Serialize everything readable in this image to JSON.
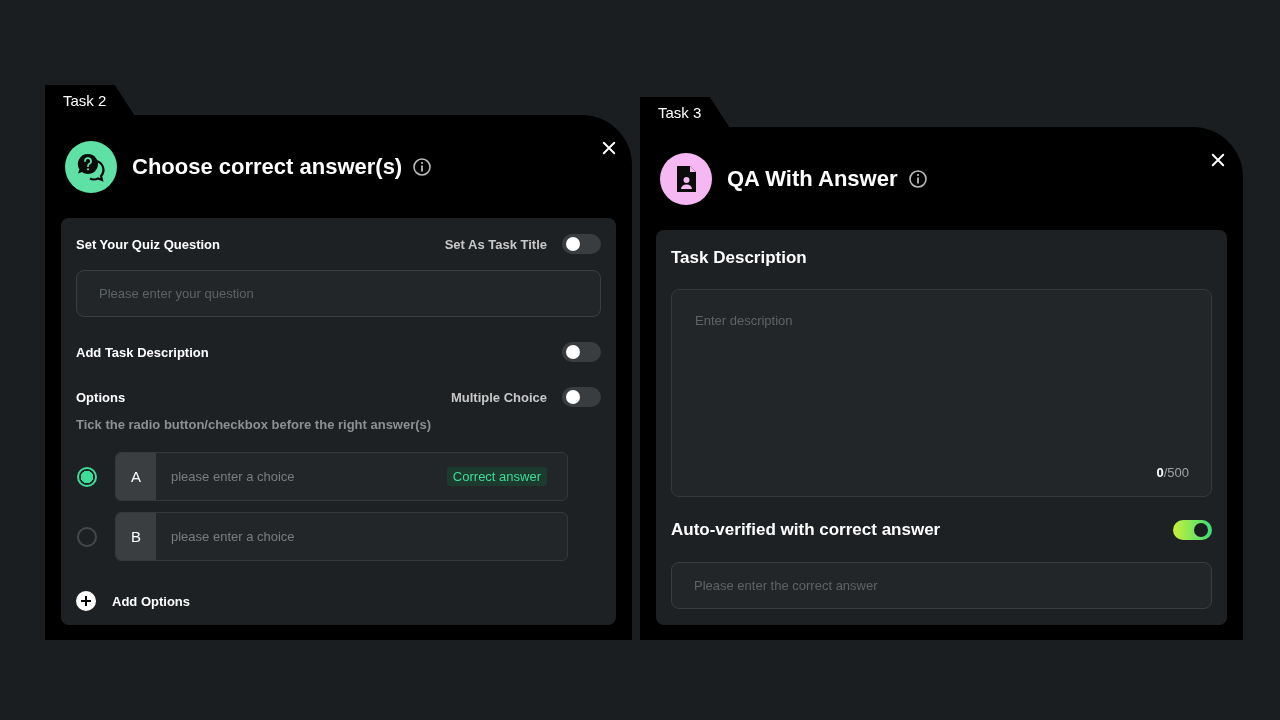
{
  "tasks": [
    {
      "kind": "quiz",
      "tab": "Task 2",
      "title": "Choose correct answer(s)",
      "question": {
        "label": "Set Your Quiz Question",
        "toggle_label": "Set As Task Title",
        "toggle_on": false,
        "placeholder": "Please enter your question"
      },
      "description": {
        "label": "Add Task Description",
        "toggle_on": false
      },
      "options": {
        "label": "Options",
        "toggle_label": "Multiple Choice",
        "toggle_on": false,
        "hint": "Tick the radio button/checkbox before the right answer(s)",
        "items": [
          {
            "letter": "A",
            "placeholder": "please enter a choice",
            "selected": true,
            "tag": "Correct answer"
          },
          {
            "letter": "B",
            "placeholder": "please enter a choice",
            "selected": false
          }
        ],
        "add_label": "Add Options"
      }
    },
    {
      "kind": "qa",
      "tab": "Task 3",
      "title": "QA With Answer",
      "description": {
        "label": "Task Description",
        "placeholder": "Enter description",
        "counter": "**0**/500"
      },
      "auto_verify": {
        "label": "Auto-verified with correct answer",
        "toggle_on": true,
        "placeholder": "Please enter the correct answer"
      }
    }
  ]
}
